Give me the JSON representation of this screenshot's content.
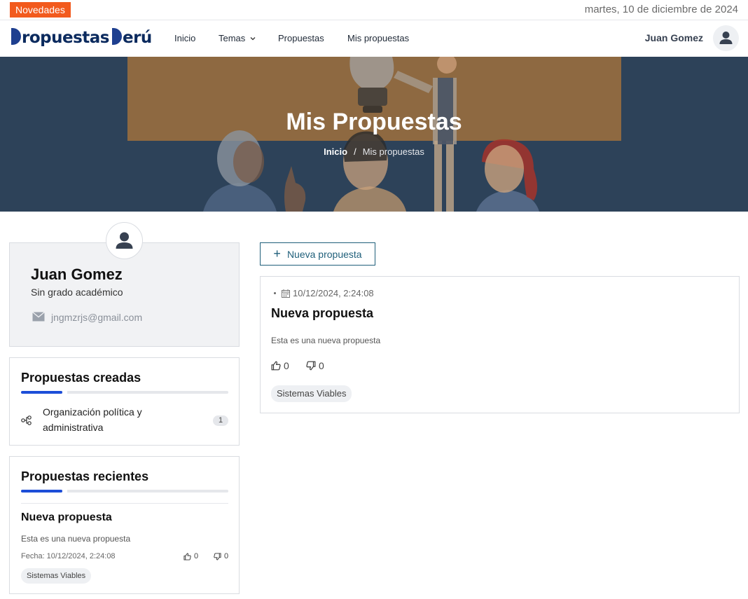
{
  "topbar": {
    "news_label": "Novedades",
    "date": "martes, 10 de diciembre de 2024"
  },
  "navbar": {
    "logo_part1": "ropuestas",
    "logo_part2": "erú",
    "items": [
      "Inicio",
      "Temas",
      "Propuestas",
      "Mis propuestas"
    ],
    "user_name": "Juan Gomez"
  },
  "hero": {
    "title": "Mis Propuestas",
    "breadcrumb_home": "Inicio",
    "breadcrumb_sep": "/",
    "breadcrumb_current": "Mis propuestas"
  },
  "profile": {
    "name": "Juan Gomez",
    "degree": "Sin grado académico",
    "email": "jngmzrjs@gmail.com"
  },
  "created": {
    "title": "Propuestas creadas",
    "category": "Organización política y administrativa",
    "count": "1"
  },
  "recent": {
    "title": "Propuestas recientes",
    "item_title": "Nueva propuesta",
    "item_desc": "Esta es una nueva propuesta",
    "item_date": "Fecha: 10/12/2024, 2:24:08",
    "likes": "0",
    "dislikes": "0",
    "tag": "Sistemas Viables"
  },
  "main": {
    "new_button": "Nueva propuesta",
    "proposal": {
      "date": "10/12/2024, 2:24:08",
      "title": "Nueva propuesta",
      "desc": "Esta es una nueva propuesta",
      "likes": "0",
      "dislikes": "0",
      "tag": "Sistemas Viables"
    }
  },
  "colors": {
    "news_badge": "#f25a1d",
    "hero_bg": "#2d4259",
    "accent_bar": "#1d4ed8",
    "button_border": "#1f5f7a"
  }
}
